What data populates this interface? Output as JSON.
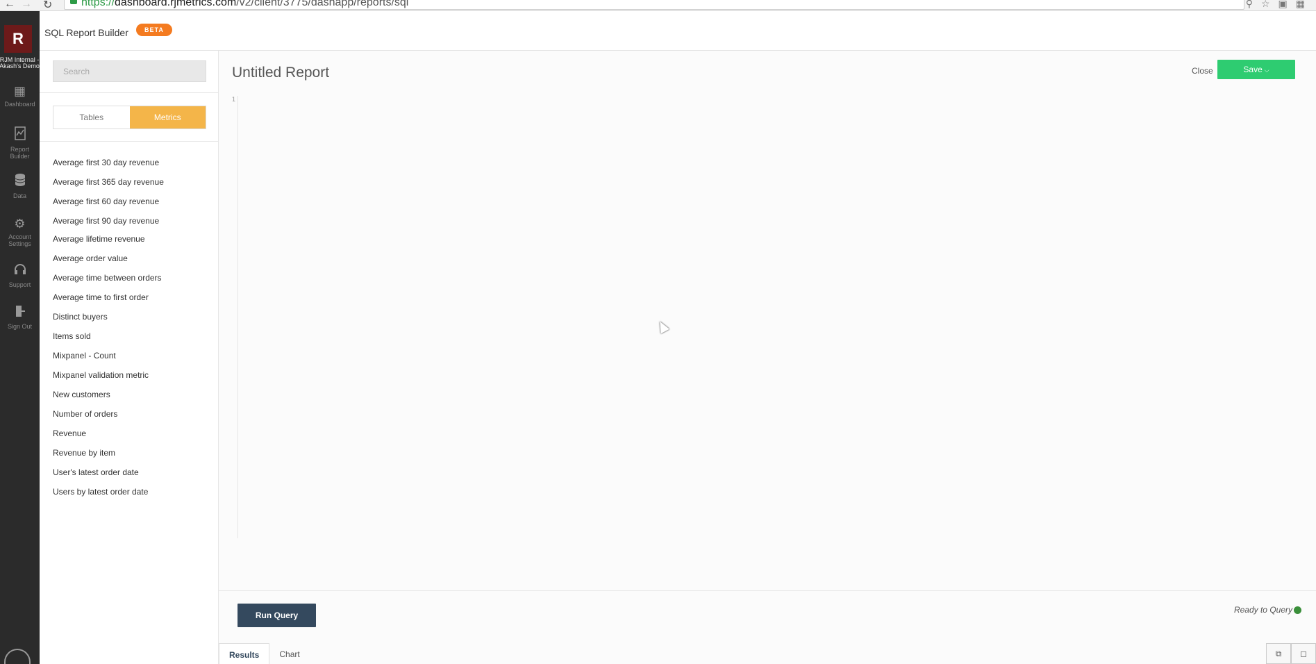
{
  "browser": {
    "url_scheme": "https://",
    "url_host": "dashboard.rjmetrics.com",
    "url_path": "/v2/client/3775/dashapp/reports/sql"
  },
  "left_nav": {
    "logo_letter": "R",
    "client_name_line1": "RJM Internal -",
    "client_name_line2": "Akash's Demo",
    "items": [
      {
        "label": "Dashboard",
        "icon": "grid-icon"
      },
      {
        "label": "Report Builder",
        "icon": "chart-icon"
      },
      {
        "label": "Data",
        "icon": "database-icon"
      },
      {
        "label": "Account Settings",
        "icon": "gear-icon"
      },
      {
        "label": "Support",
        "icon": "headset-icon"
      },
      {
        "label": "Sign Out",
        "icon": "signout-icon"
      }
    ]
  },
  "header": {
    "title": "SQL Report Builder",
    "badge": "BETA"
  },
  "side_panel": {
    "search_placeholder": "Search",
    "tabs": {
      "tables": "Tables",
      "metrics": "Metrics",
      "active": "metrics"
    },
    "metrics": [
      "Average first 30 day revenue",
      "Average first 365 day revenue",
      "Average first 60 day revenue",
      "Average first 90 day revenue",
      "Average lifetime revenue",
      "Average order value",
      "Average time between orders",
      "Average time to first order",
      "Distinct buyers",
      "Items sold",
      "Mixpanel - Count",
      "Mixpanel validation metric",
      "New customers",
      "Number of orders",
      "Revenue",
      "Revenue by item",
      "User's latest order date",
      "Users by latest order date"
    ]
  },
  "main": {
    "report_title": "Untitled Report",
    "close_label": "Close",
    "save_label": "Save",
    "editor_line_number": "1",
    "run_query_label": "Run Query",
    "status_text": "Ready to Query",
    "status_color": "#3a8f3a",
    "result_tabs": [
      "Results",
      "Chart"
    ]
  },
  "colors": {
    "accent_orange": "#f47b20",
    "metrics_tab": "#f4b549",
    "save_green": "#2ecc71",
    "run_button": "#34495e",
    "nav_dark": "#2b2b2b"
  }
}
